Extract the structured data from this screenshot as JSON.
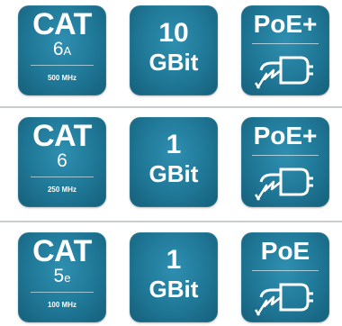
{
  "rows": [
    {
      "cat": {
        "label": "CAT",
        "sub_main": "6",
        "sub_suffix": "A",
        "frequency": "500 MHz"
      },
      "speed": {
        "value": "10",
        "unit": "GBit"
      },
      "poe": {
        "label": "PoE+",
        "icon": "poe-plug-lightning-icon"
      }
    },
    {
      "cat": {
        "label": "CAT",
        "sub_main": "6",
        "sub_suffix": "",
        "frequency": "250 MHz"
      },
      "speed": {
        "value": "1",
        "unit": "GBit"
      },
      "poe": {
        "label": "PoE+",
        "icon": "poe-plug-lightning-icon"
      }
    },
    {
      "cat": {
        "label": "CAT",
        "sub_main": "5",
        "sub_suffix": "e",
        "frequency": "100 MHz"
      },
      "speed": {
        "value": "1",
        "unit": "GBit"
      },
      "poe": {
        "label": "PoE",
        "icon": "poe-plug-lightning-icon"
      }
    }
  ],
  "colors": {
    "tile_bg": "#1f7796",
    "tile_highlight": "#2f8fb0",
    "text": "#ffffff",
    "divider": "#c9cdcf"
  }
}
